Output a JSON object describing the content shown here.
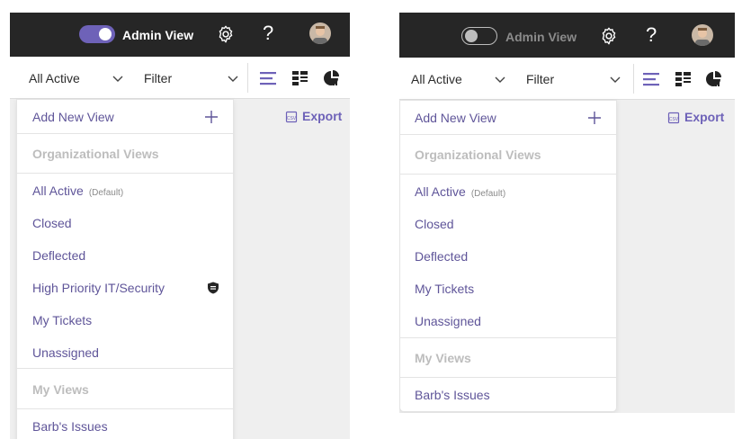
{
  "colors": {
    "topbar": "#262626",
    "accent": "#6e62b8",
    "item_text": "#5f5599",
    "header_text": "#bdbdbd",
    "content_bg": "#efefef"
  },
  "left": {
    "admin_toggle": {
      "state": "on",
      "label": "Admin View"
    },
    "filterbar": {
      "view_select": "All Active",
      "filter_select": "Filter"
    },
    "export_label": "Export",
    "dropdown": {
      "add_new_view": "Add New View",
      "org_views_header": "Organizational Views",
      "org_items": [
        {
          "label": "All Active",
          "default_tag": "(Default)"
        },
        {
          "label": "Closed"
        },
        {
          "label": "Deflected"
        },
        {
          "label": "High Priority IT/Security",
          "icon": "shield-icon"
        },
        {
          "label": "My Tickets"
        },
        {
          "label": "Unassigned"
        }
      ],
      "my_views_header": "My Views",
      "my_items": [
        {
          "label": "Barb's Issues"
        }
      ]
    }
  },
  "right": {
    "admin_toggle": {
      "state": "off",
      "label": "Admin View"
    },
    "filterbar": {
      "view_select": "All Active",
      "filter_select": "Filter"
    },
    "export_label": "Export",
    "dropdown": {
      "add_new_view": "Add New View",
      "org_views_header": "Organizational Views",
      "org_items": [
        {
          "label": "All Active",
          "default_tag": "(Default)"
        },
        {
          "label": "Closed"
        },
        {
          "label": "Deflected"
        },
        {
          "label": "My Tickets"
        },
        {
          "label": "Unassigned"
        }
      ],
      "my_views_header": "My Views",
      "my_items": [
        {
          "label": "Barb's Issues"
        }
      ]
    }
  }
}
